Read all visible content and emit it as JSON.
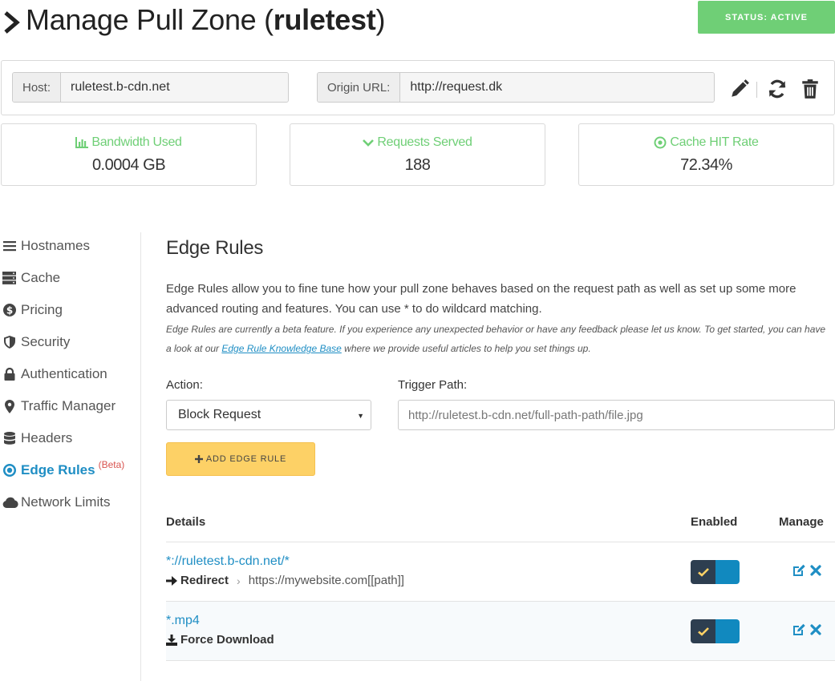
{
  "header": {
    "title_prefix": "Manage Pull Zone (",
    "title_name": "ruletest",
    "title_suffix": ")",
    "status_label": "STATUS: ACTIVE"
  },
  "zone": {
    "host_label": "Host:",
    "host_value": "ruletest.b-cdn.net",
    "origin_label": "Origin URL:",
    "origin_value": "http://request.dk"
  },
  "stats": [
    {
      "label": "Bandwidth Used",
      "value": "0.0004 GB",
      "icon": "bar-chart-icon"
    },
    {
      "label": "Requests Served",
      "value": "188",
      "icon": "chevron-down-icon"
    },
    {
      "label": "Cache HIT Rate",
      "value": "72.34%",
      "icon": "target-icon"
    }
  ],
  "sidebar": {
    "items": [
      {
        "label": "Hostnames",
        "icon": "list-icon"
      },
      {
        "label": "Cache",
        "icon": "server-icon"
      },
      {
        "label": "Pricing",
        "icon": "dollar-icon"
      },
      {
        "label": "Security",
        "icon": "shield-icon"
      },
      {
        "label": "Authentication",
        "icon": "lock-icon"
      },
      {
        "label": "Traffic Manager",
        "icon": "map-marker-icon"
      },
      {
        "label": "Headers",
        "icon": "database-icon"
      },
      {
        "label": "Edge Rules",
        "icon": "dot-circle-icon",
        "badge": "(Beta)",
        "active": true
      },
      {
        "label": "Network Limits",
        "icon": "cloud-icon"
      }
    ]
  },
  "main": {
    "title": "Edge Rules",
    "description": "Edge Rules allow you to fine tune how your pull zone behaves based on the request path as well as set up some more advanced routing and features. You can use * to do wildcard matching.",
    "note_before": "Edge Rules are currently a beta feature. If you experience any unexpected behavior or have any feedback please let us know. To get started, you can have a look at our ",
    "note_link": "Edge Rule Knowledge Base",
    "note_after": " where we provide useful articles to help you set things up.",
    "action_label": "Action:",
    "action_value": "Block Request",
    "trigger_label": "Trigger Path:",
    "trigger_placeholder": "http://ruletest.b-cdn.net/full-path-path/file.jpg",
    "add_button": "ADD EDGE RULE"
  },
  "table": {
    "headers": {
      "details": "Details",
      "enabled": "Enabled",
      "manage": "Manage"
    },
    "rows": [
      {
        "path": "*://ruletest.b-cdn.net/*",
        "action": "Redirect",
        "destination": "https://mywebsite.com[[path]]",
        "enabled": true
      },
      {
        "path": "*.mp4",
        "action": "Force Download",
        "destination": "",
        "enabled": true
      }
    ]
  },
  "colors": {
    "accent_green": "#6fcf76",
    "accent_blue": "#1f8ec4",
    "add_button": "#fdd166",
    "toggle_dark": "#2d3e50",
    "toggle_blue": "#1189bf"
  }
}
